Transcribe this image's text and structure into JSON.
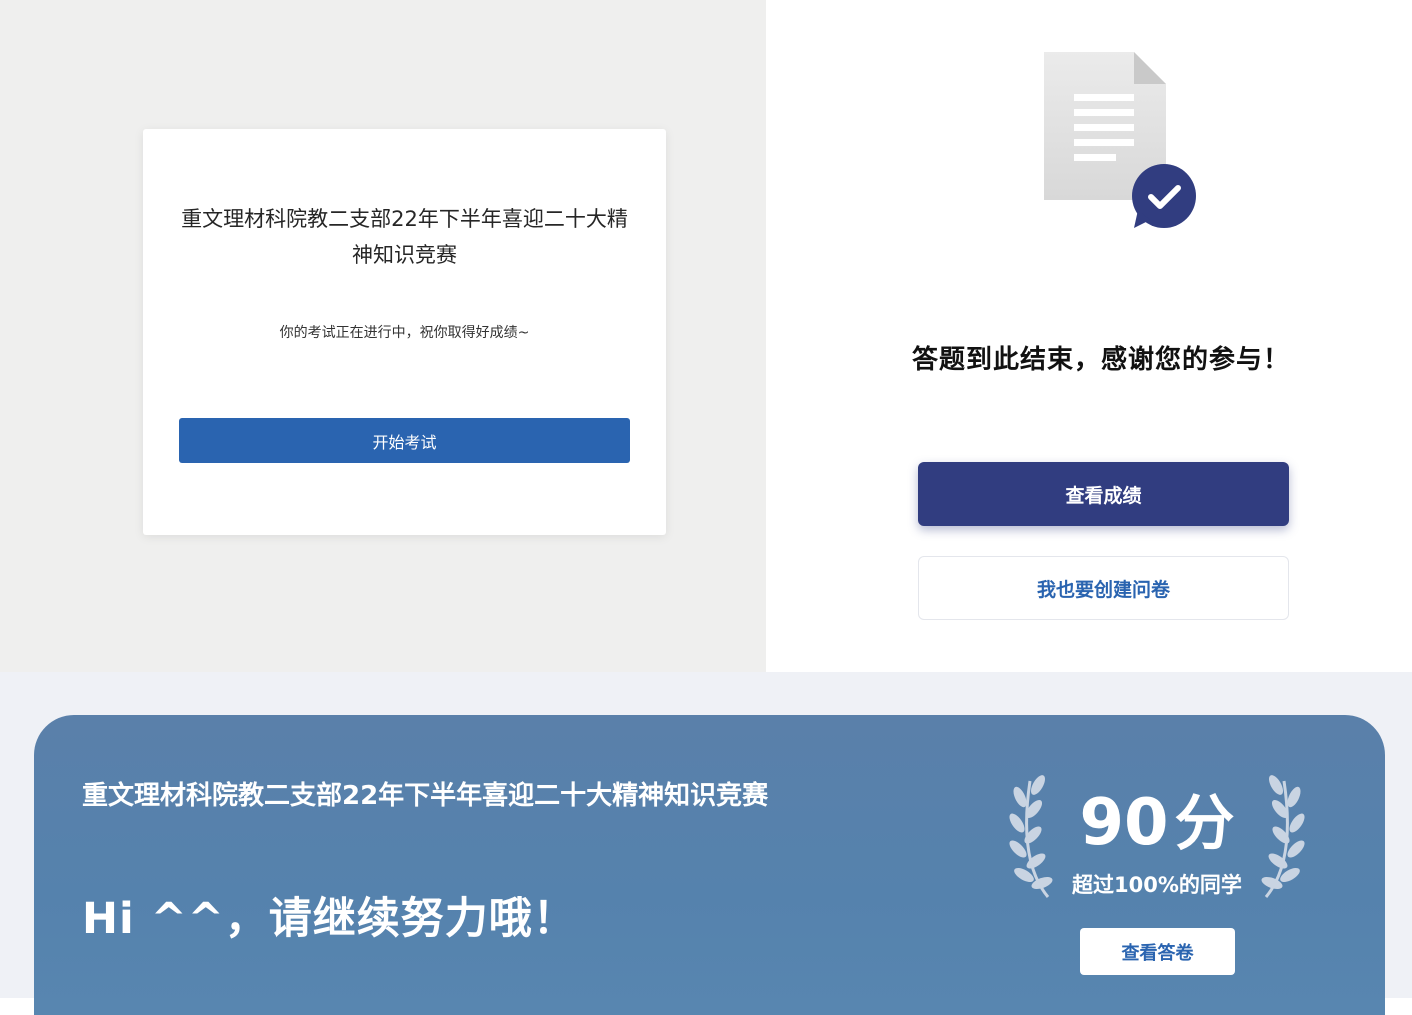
{
  "exam": {
    "title": "重文理材科院教二支部22年下半年喜迎二十大精神知识竞赛",
    "subtitle": "你的考试正在进行中，祝你取得好成绩~",
    "start_label": "开始考试"
  },
  "completion": {
    "message": "答题到此结束，感谢您的参与！",
    "view_score_label": "查看成绩",
    "create_survey_label": "我也要创建问卷"
  },
  "result": {
    "title": "重文理材科院教二支部22年下半年喜迎二十大精神知识竞赛",
    "encouragement": "Hi ^^，请继续努力哦！",
    "score_number": "90",
    "score_unit": "分",
    "rank_text": "超过100%的同学",
    "view_answers_label": "查看答卷"
  },
  "colors": {
    "primary_blue": "#2a64b0",
    "navy": "#313d80",
    "banner_blue": "#5582ad",
    "gray_background": "#efefee"
  },
  "icons": {
    "document": "document-icon",
    "check_badge": "check-badge-icon",
    "laurel": "laurel-icon"
  }
}
